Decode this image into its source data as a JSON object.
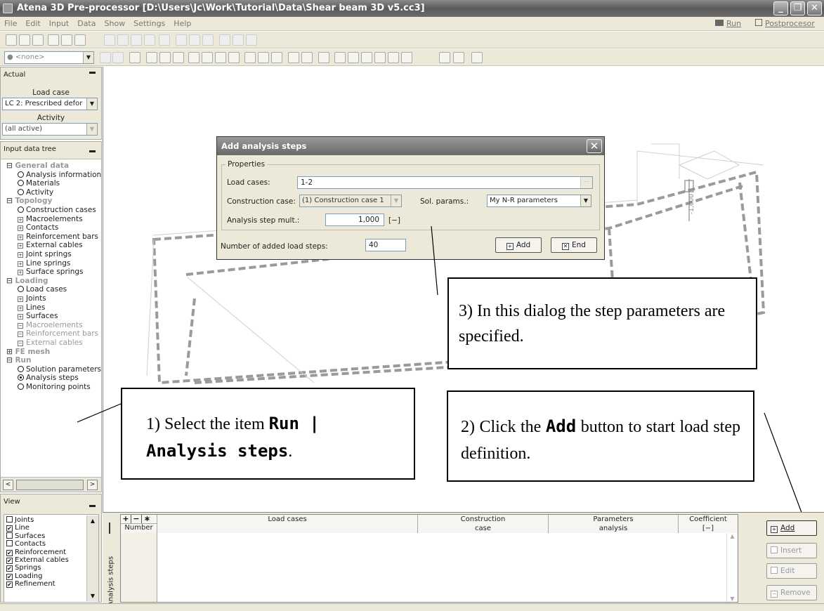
{
  "window": {
    "title": "Atena 3D Pre-processor [D:\\Users\\Jc\\Work\\Tutorial\\Data\\Shear beam 3D v5.cc3]",
    "min": "_",
    "max": "❐",
    "close": "✕"
  },
  "menu": {
    "items": [
      "File",
      "Edit",
      "Input",
      "Data",
      "Show",
      "Settings",
      "Help"
    ],
    "run": "Run",
    "postprocessor": "Postprocesor"
  },
  "toolbar": {
    "none_combo": "<none>"
  },
  "actual": {
    "header": "Actual",
    "load_case_label": "Load case",
    "load_case_value": "LC 2: Prescribed defor",
    "activity_label": "Activity",
    "activity_value": "(all active)"
  },
  "tree": {
    "header": "Input data tree",
    "items": [
      {
        "text": "General data",
        "kind": "group",
        "prefix": "⊟"
      },
      {
        "text": "Analysis information",
        "kind": "circle"
      },
      {
        "text": "Materials",
        "kind": "circle"
      },
      {
        "text": "Activity",
        "kind": "circle"
      },
      {
        "text": "Topology",
        "kind": "group",
        "prefix": "⊟"
      },
      {
        "text": "Construction cases",
        "kind": "circle"
      },
      {
        "text": "Macroelements",
        "kind": "plus"
      },
      {
        "text": "Contacts",
        "kind": "plus"
      },
      {
        "text": "Reinforcement bars",
        "kind": "plus"
      },
      {
        "text": "External cables",
        "kind": "plus"
      },
      {
        "text": "Joint springs",
        "kind": "plus"
      },
      {
        "text": "Line springs",
        "kind": "plus"
      },
      {
        "text": "Surface springs",
        "kind": "plus"
      },
      {
        "text": "Loading",
        "kind": "group",
        "prefix": "⊟"
      },
      {
        "text": "Load cases",
        "kind": "circle"
      },
      {
        "text": "Joints",
        "kind": "plus"
      },
      {
        "text": "Lines",
        "kind": "plus"
      },
      {
        "text": "Surfaces",
        "kind": "plus"
      },
      {
        "text": "Macroelements",
        "kind": "dim"
      },
      {
        "text": "Reinforcement bars",
        "kind": "dim"
      },
      {
        "text": "External cables",
        "kind": "dim"
      },
      {
        "text": "FE mesh",
        "kind": "group",
        "prefix": "⊞"
      },
      {
        "text": "Run",
        "kind": "group",
        "prefix": "⊟"
      },
      {
        "text": "Solution parameters",
        "kind": "circle"
      },
      {
        "text": "Analysis steps",
        "kind": "selected"
      },
      {
        "text": "Monitoring points",
        "kind": "circle"
      }
    ]
  },
  "view": {
    "header": "View",
    "items": [
      {
        "text": "Joints",
        "checked": false
      },
      {
        "text": "Line",
        "checked": true
      },
      {
        "text": "Surfaces",
        "checked": false
      },
      {
        "text": "Contacts",
        "checked": false
      },
      {
        "text": "Reinforcement",
        "checked": true
      },
      {
        "text": "External cables",
        "checked": true
      },
      {
        "text": "Springs",
        "checked": true
      },
      {
        "text": "Loading",
        "checked": true
      },
      {
        "text": "Refinement",
        "checked": true
      }
    ]
  },
  "dialog": {
    "title": "Add analysis steps",
    "group": "Properties",
    "load_cases_label": "Load cases:",
    "load_cases_value": "1-2",
    "construction_label": "Construction case:",
    "construction_value": "(1) Construction case 1",
    "sol_params_label": "Sol. params.:",
    "sol_params_value": "My N-R parameters",
    "mult_label": "Analysis step mult.:",
    "mult_value": "1,000",
    "mult_unit": "[−]",
    "steps_label": "Number of added load steps:",
    "steps_value": "40",
    "add_button": "Add",
    "end_button": "End"
  },
  "grid": {
    "side_label": "Analysis steps",
    "tool_plus": "+",
    "tool_minus": "−",
    "tool_star": "∗",
    "number_header": "Number",
    "columns": [
      {
        "top": "Load cases",
        "bottom": ""
      },
      {
        "top": "Construction",
        "bottom": "case"
      },
      {
        "top": "Parameters",
        "bottom": "analysis"
      },
      {
        "top": "Coefficient",
        "bottom": "[−]"
      }
    ],
    "buttons": {
      "add": "Add",
      "insert": "Insert",
      "edit": "Edit",
      "remove": "Remove"
    }
  },
  "callouts": {
    "c1_pre": "1) Select the item ",
    "c1_code1": "Run |",
    "c1_code2": "Analysis steps",
    "c1_post": ".",
    "c2_pre": "2) Click the ",
    "c2_code": "Add",
    "c2_post": " button to start load step definition.",
    "c3": "3) In this dialog the step parameters are specified."
  },
  "viewport": {
    "dim_label": "-1,000"
  }
}
